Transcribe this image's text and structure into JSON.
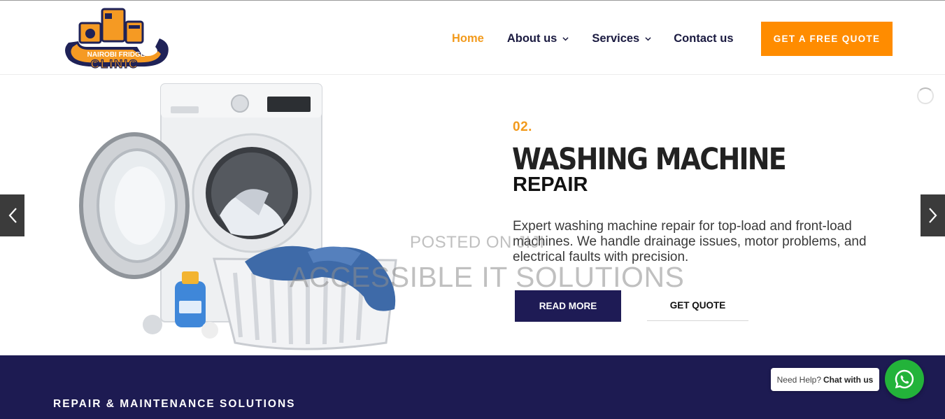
{
  "header": {
    "logo": {
      "line1": "NAIROBI FRIDGE",
      "line2": "CLINIC",
      "icon": "appliances-logo"
    },
    "nav": [
      {
        "label": "Home",
        "active": true
      },
      {
        "label": "About us",
        "dropdown": true
      },
      {
        "label": "Services",
        "dropdown": true
      },
      {
        "label": "Contact us"
      }
    ],
    "cta": "GET A FREE QUOTE"
  },
  "hero": {
    "number": "02.",
    "title": "WASHING MACHINE",
    "subtitle": "REPAIR",
    "description": "Expert washing machine repair for top-load and front-load machines. We handle drainage issues, motor problems, and electrical faults with precision.",
    "read_more": "READ MORE",
    "get_quote": "GET QUOTE",
    "image": "washing-machine-with-laundry-basket",
    "prev_icon": "chevron-left-icon",
    "next_icon": "chevron-right-icon"
  },
  "watermark": {
    "line1": "POSTED ON JIJI",
    "line2": "ACCESSIBLE IT SOLUTIONS"
  },
  "band": {
    "title": "REPAIR & MAINTENANCE SOLUTIONS"
  },
  "chat": {
    "prefix": "Need Help?",
    "action": "Chat with us",
    "icon": "whatsapp-icon"
  },
  "colors": {
    "accent": "#f29a1c",
    "cta": "#ff8c00",
    "navy": "#1d1b52",
    "whatsapp": "#23b33a"
  }
}
